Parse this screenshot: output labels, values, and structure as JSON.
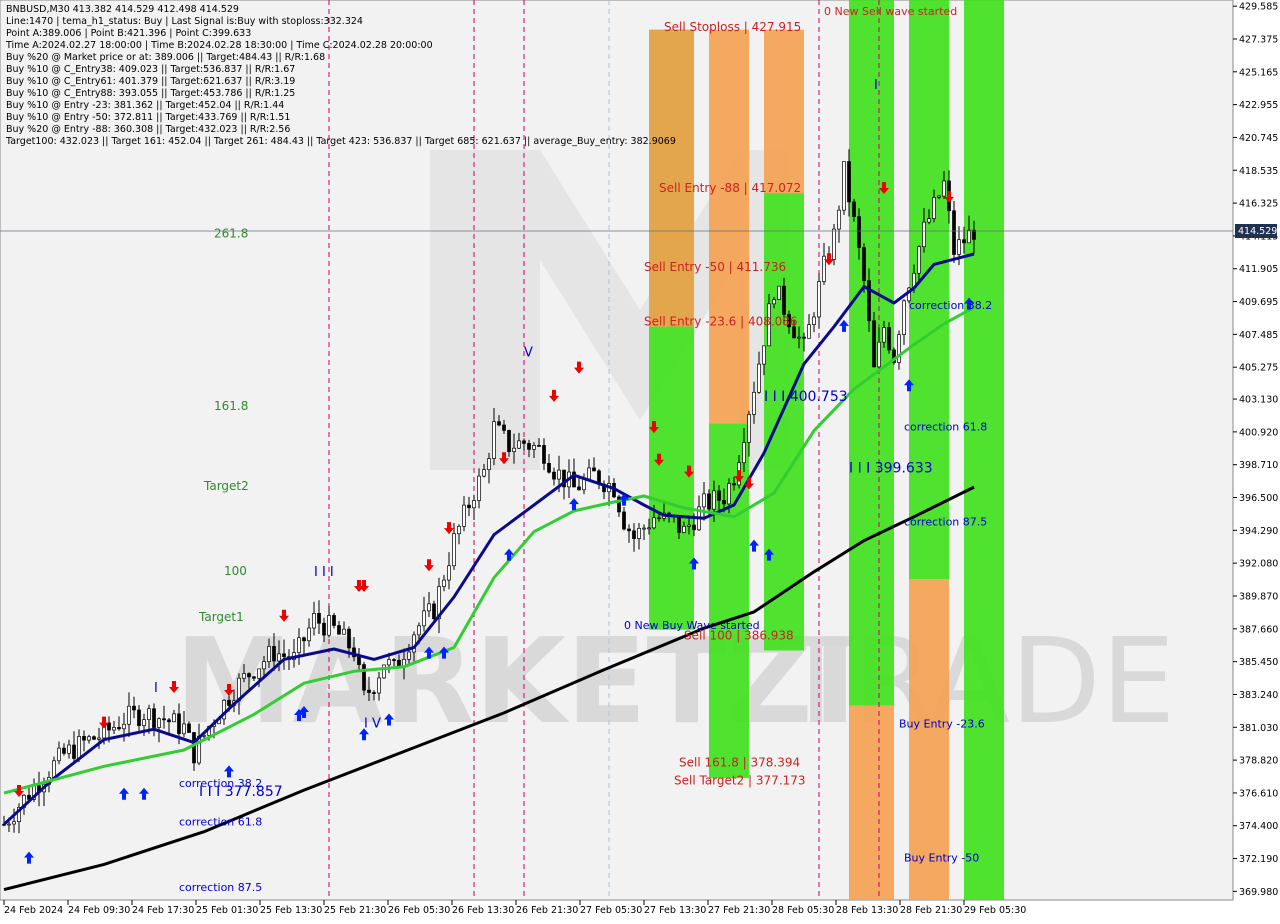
{
  "colors": {
    "background": "#ffffff",
    "plot_bg": "#f2f2f2",
    "watermark": "#d2d2d2",
    "candle": "#000000",
    "blue_line": "#0a0a8c",
    "green_line": "#33cc33",
    "black_line": "#000000",
    "green_zone": "#3de01a",
    "orange_zone": "#f4a050",
    "sell_text": "#cc2222",
    "buy_text": "#0000cc",
    "fib_text": "#2e8b2e",
    "vline_red": "#cc0066",
    "vline_blue": "#9ec8e0",
    "arrow_red": "#ee0000",
    "arrow_blue": "#0022ff",
    "price_tag": "#203050"
  },
  "header": {
    "lines": [
      "BNBUSD,M30  413.382 414.529 412.498 414.529",
      "Line:1470  | tema_h1_status: Buy  | Last Signal is:Buy with stoploss:332.324",
      "Point A:389.006 | Point B:421.396 | Point C:399.633",
      "Time A:2024.02.27 18:00:00 | Time B:2024.02.28 18:30:00 | Time C:2024.02.28 20:00:00",
      "Buy %20 @ Market price or at: 389.006  ||  Target:484.43  ||  R/R:1.68",
      "Buy %10 @ C_Entry38: 409.023  ||  Target:536.837  ||  R/R:1.67",
      "Buy %10 @ C_Entry61: 401.379  ||  Target:621.637  ||  R/R:3.19",
      "Buy %10 @ C_Entry88: 393.055  ||  Target:453.786  ||  R/R:1.25",
      "Buy %10 @ Entry -23: 381.362  ||  Target:452.04  ||  R/R:1.44",
      "Buy %10 @ Entry -50: 372.811  ||  Target:433.769  ||  R/R:1.51",
      "Buy %20 @ Entry -88: 360.308  ||  Target:432.023  ||  R/R:2.56",
      "Target100: 432.023  ||  Target 161: 452.04  ||  Target 261: 484.43  ||  Target 423: 536.837  ||  Target 685: 621.637  ||  average_Buy_entry: 382.9069"
    ]
  },
  "watermark": {
    "text_left": "MARKETZI",
    "text_right": "TRADE"
  },
  "current_price": "414.529",
  "chart_data": {
    "type": "candlestick",
    "symbol": "BNBUSD",
    "timeframe": "M30",
    "ylim": [
      369.4,
      430.0
    ],
    "y_ticks": [
      "429.585",
      "427.375",
      "425.165",
      "422.955",
      "420.745",
      "418.535",
      "416.325",
      "414.115",
      "411.905",
      "409.695",
      "407.485",
      "405.275",
      "403.130",
      "400.920",
      "398.710",
      "396.500",
      "394.290",
      "392.080",
      "389.870",
      "387.660",
      "385.450",
      "383.240",
      "381.030",
      "378.820",
      "376.610",
      "374.400",
      "372.190",
      "369.980"
    ],
    "x_ticks": [
      "24 Feb 2024",
      "24 Feb 09:30",
      "24 Feb 17:30",
      "25 Feb 01:30",
      "25 Feb 13:30",
      "25 Feb 21:30",
      "26 Feb 05:30",
      "26 Feb 13:30",
      "26 Feb 21:30",
      "27 Feb 05:30",
      "27 Feb 13:30",
      "27 Feb 21:30",
      "28 Feb 05:30",
      "28 Feb 13:30",
      "28 Feb 21:30",
      "29 Feb 05:30"
    ],
    "close_path": [
      [
        0,
        374.5
      ],
      [
        4,
        376.2
      ],
      [
        8,
        377.8
      ],
      [
        12,
        379.2
      ],
      [
        16,
        380.0
      ],
      [
        20,
        380.6
      ],
      [
        24,
        381.6
      ],
      [
        28,
        382.0
      ],
      [
        32,
        381.6
      ],
      [
        36,
        381.0
      ],
      [
        38,
        379.3
      ],
      [
        42,
        381.7
      ],
      [
        46,
        383.6
      ],
      [
        50,
        385.0
      ],
      [
        54,
        386.1
      ],
      [
        58,
        385.6
      ],
      [
        62,
        388.3
      ],
      [
        66,
        387.6
      ],
      [
        70,
        386.2
      ],
      [
        72,
        383.0
      ],
      [
        74,
        384.0
      ],
      [
        76,
        385.5
      ],
      [
        78,
        384.9
      ],
      [
        82,
        387.5
      ],
      [
        86,
        389.0
      ],
      [
        90,
        393.6
      ],
      [
        94,
        396.9
      ],
      [
        96,
        398.2
      ],
      [
        98,
        401.2
      ],
      [
        101,
        400.0
      ],
      [
        104,
        400.2
      ],
      [
        108,
        399.6
      ],
      [
        110,
        398.4
      ],
      [
        114,
        397.1
      ],
      [
        118,
        398.0
      ],
      [
        122,
        397.2
      ],
      [
        124,
        395.0
      ],
      [
        126,
        393.8
      ],
      [
        128,
        394.5
      ],
      [
        130,
        395.2
      ],
      [
        134,
        394.8
      ],
      [
        136,
        394.2
      ],
      [
        140,
        396.0
      ],
      [
        144,
        396.6
      ],
      [
        146,
        398.0
      ],
      [
        150,
        404.0
      ],
      [
        154,
        410.6
      ],
      [
        157,
        408.6
      ],
      [
        160,
        406.5
      ],
      [
        164,
        412.0
      ],
      [
        166,
        414.1
      ],
      [
        168,
        418.4
      ],
      [
        170,
        415.0
      ],
      [
        172,
        411.0
      ],
      [
        174,
        405.0
      ],
      [
        176,
        408.0
      ],
      [
        178,
        406.0
      ],
      [
        180,
        410.0
      ],
      [
        184,
        414.5
      ],
      [
        188,
        417.6
      ],
      [
        190,
        413.1
      ],
      [
        194,
        414.529
      ]
    ],
    "n_bars": 194,
    "series": [
      {
        "name": "",
        "color": "blue_line",
        "points": [
          [
            0,
            374.5
          ],
          [
            10,
            377.6
          ],
          [
            20,
            380.2
          ],
          [
            30,
            380.9
          ],
          [
            38,
            380.0
          ],
          [
            46,
            382.6
          ],
          [
            56,
            385.6
          ],
          [
            66,
            386.3
          ],
          [
            74,
            385.6
          ],
          [
            82,
            386.4
          ],
          [
            90,
            389.8
          ],
          [
            98,
            394.0
          ],
          [
            106,
            396.0
          ],
          [
            114,
            398.0
          ],
          [
            122,
            397.1
          ],
          [
            128,
            396.0
          ],
          [
            132,
            395.3
          ],
          [
            140,
            395.1
          ],
          [
            146,
            396.0
          ],
          [
            152,
            399.5
          ],
          [
            160,
            405.5
          ],
          [
            166,
            408.0
          ],
          [
            172,
            410.7
          ],
          [
            178,
            409.6
          ],
          [
            182,
            410.6
          ],
          [
            186,
            412.2
          ],
          [
            194,
            412.9
          ]
        ]
      },
      {
        "name": "",
        "color": "green_line",
        "points": [
          [
            0,
            376.6
          ],
          [
            20,
            378.4
          ],
          [
            36,
            379.5
          ],
          [
            50,
            381.9
          ],
          [
            60,
            384.0
          ],
          [
            70,
            384.8
          ],
          [
            80,
            385.1
          ],
          [
            90,
            386.4
          ],
          [
            98,
            391.1
          ],
          [
            106,
            394.2
          ],
          [
            114,
            395.6
          ],
          [
            122,
            396.2
          ],
          [
            128,
            396.6
          ],
          [
            136,
            395.8
          ],
          [
            146,
            395.2
          ],
          [
            154,
            396.8
          ],
          [
            162,
            401.0
          ],
          [
            170,
            403.8
          ],
          [
            176,
            405.3
          ],
          [
            182,
            406.8
          ],
          [
            188,
            408.2
          ],
          [
            194,
            409.3
          ]
        ]
      },
      {
        "name": "",
        "color": "black_line",
        "points": [
          [
            0,
            370.1
          ],
          [
            20,
            371.8
          ],
          [
            40,
            374.0
          ],
          [
            60,
            376.8
          ],
          [
            80,
            379.4
          ],
          [
            100,
            382.0
          ],
          [
            120,
            384.9
          ],
          [
            140,
            387.7
          ],
          [
            150,
            388.8
          ],
          [
            162,
            391.5
          ],
          [
            172,
            393.6
          ],
          [
            182,
            395.2
          ],
          [
            194,
            397.2
          ]
        ]
      }
    ],
    "vertical_lines": [
      {
        "time_bar": 65,
        "style": "red"
      },
      {
        "time_bar": 94,
        "style": "red"
      },
      {
        "time_bar": 104,
        "style": "red"
      },
      {
        "time_bar": 121,
        "style": "blue"
      },
      {
        "time_bar": 163,
        "style": "red"
      },
      {
        "time_bar": 175,
        "style": "red"
      }
    ],
    "zones": [
      {
        "color": "green_zone",
        "x_from": 129,
        "x_to": 138,
        "y_from": 387.6,
        "y_to": 428.0
      },
      {
        "color": "orange_zone",
        "x_from": 129,
        "x_to": 138,
        "y_from": 408.0,
        "y_to": 428.0
      },
      {
        "color": "green_zone",
        "x_from": 141,
        "x_to": 149,
        "y_from": 377.6,
        "y_to": 401.5
      },
      {
        "color": "orange_zone",
        "x_from": 141,
        "x_to": 149,
        "y_from": 401.5,
        "y_to": 428.0
      },
      {
        "color": "green_zone",
        "x_from": 152,
        "x_to": 160,
        "y_from": 386.2,
        "y_to": 417.0
      },
      {
        "color": "orange_zone",
        "x_from": 152,
        "x_to": 160,
        "y_from": 417.0,
        "y_to": 428.0
      },
      {
        "color": "green_zone",
        "x_from": 169,
        "x_to": 178,
        "y_from": 382.5,
        "y_to": 430.0
      },
      {
        "color": "orange_zone",
        "x_from": 169,
        "x_to": 178,
        "y_from": 369.4,
        "y_to": 382.5
      },
      {
        "color": "green_zone",
        "x_from": 181,
        "x_to": 189,
        "y_from": 391.0,
        "y_to": 430.0
      },
      {
        "color": "orange_zone",
        "x_from": 181,
        "x_to": 189,
        "y_from": 369.4,
        "y_to": 391.0
      },
      {
        "color": "green_zone",
        "x_from": 192,
        "x_to": 200,
        "y_from": 369.4,
        "y_to": 430.0
      }
    ],
    "up_arrows": [
      [
        5,
        373.2
      ],
      [
        24,
        377.5
      ],
      [
        28,
        377.5
      ],
      [
        45,
        379.0
      ],
      [
        59,
        382.8
      ],
      [
        60,
        383.0
      ],
      [
        72,
        381.5
      ],
      [
        77,
        382.5
      ],
      [
        85,
        387.0
      ],
      [
        88,
        387.0
      ],
      [
        101,
        393.6
      ],
      [
        114,
        397.0
      ],
      [
        124,
        397.3
      ],
      [
        138,
        393.0
      ],
      [
        150,
        394.2
      ],
      [
        153,
        393.6
      ],
      [
        168,
        409.0
      ],
      [
        181,
        405.0
      ],
      [
        193,
        410.5
      ]
    ],
    "down_arrows": [
      [
        3,
        375.8
      ],
      [
        20,
        380.4
      ],
      [
        34,
        382.8
      ],
      [
        45,
        382.6
      ],
      [
        56,
        387.6
      ],
      [
        71,
        389.6
      ],
      [
        72,
        389.6
      ],
      [
        85,
        391.0
      ],
      [
        89,
        393.5
      ],
      [
        100,
        398.2
      ],
      [
        110,
        402.4
      ],
      [
        115,
        404.3
      ],
      [
        130,
        400.3
      ],
      [
        131,
        398.1
      ],
      [
        137,
        397.3
      ],
      [
        147,
        397.0
      ],
      [
        149,
        396.5
      ],
      [
        165,
        411.6
      ],
      [
        176,
        416.4
      ],
      [
        189,
        415.8
      ]
    ],
    "price_labels": [
      {
        "text": "Sell Stoploss | 427.915",
        "color": "sell_text",
        "time_bar": 132,
        "price": 427.915,
        "size": 12
      },
      {
        "text": "Sell Entry -88 | 417.072",
        "color": "sell_text",
        "time_bar": 131,
        "price": 417.072,
        "size": 12
      },
      {
        "text": "Sell Entry -50 | 411.736",
        "color": "sell_text",
        "time_bar": 128,
        "price": 411.736,
        "size": 12
      },
      {
        "text": "Sell Entry -23.6 | 408.086",
        "color": "sell_text",
        "time_bar": 128,
        "price": 408.086,
        "size": 12
      },
      {
        "text": "I I I  400.753",
        "color": "buy_text",
        "time_bar": 152,
        "price": 403.0,
        "size": 14
      },
      {
        "text": "I I I  399.633",
        "color": "buy_text",
        "time_bar": 169,
        "price": 398.2,
        "size": 14
      },
      {
        "text": "Sell 100 | 386.938",
        "color": "sell_text",
        "time_bar": 136,
        "price": 386.938,
        "size": 12
      },
      {
        "text": "Sell 161.8 | 378.394",
        "color": "sell_text",
        "time_bar": 135,
        "price": 378.394,
        "size": 12
      },
      {
        "text": "Sell Target2 | 377.173",
        "color": "sell_text",
        "time_bar": 134,
        "price": 377.173,
        "size": 12
      },
      {
        "text": "0 New Sell wave started",
        "color": "sell_text",
        "time_bar": 164,
        "price": 429.0,
        "size": 11
      },
      {
        "text": "0 New Buy Wave started",
        "color": "buy_text",
        "time_bar": 124,
        "price": 387.66,
        "size": 11
      },
      {
        "text": "correction 38.2",
        "color": "buy_text",
        "time_bar": 181,
        "price": 409.2,
        "size": 11
      },
      {
        "text": "correction 61.8",
        "color": "buy_text",
        "time_bar": 180,
        "price": 401.0,
        "size": 11
      },
      {
        "text": "correction 87.5",
        "color": "buy_text",
        "time_bar": 180,
        "price": 394.6,
        "size": 11
      },
      {
        "text": "Buy Entry -23.6",
        "color": "buy_text",
        "time_bar": 179,
        "price": 381.0,
        "size": 11
      },
      {
        "text": "Buy Entry -50",
        "color": "buy_text",
        "time_bar": 180,
        "price": 372.0,
        "size": 11
      },
      {
        "text": "I I I  377.857",
        "color": "buy_text",
        "time_bar": 39,
        "price": 376.4,
        "size": 14
      },
      {
        "text": "correction 38.2",
        "color": "buy_text",
        "time_bar": 35,
        "price": 377.0,
        "size": 11
      },
      {
        "text": "correction 61.8",
        "color": "buy_text",
        "time_bar": 35,
        "price": 374.4,
        "size": 11
      },
      {
        "text": "correction 87.5",
        "color": "buy_text",
        "time_bar": 35,
        "price": 370.0,
        "size": 11
      },
      {
        "text": "I V",
        "color": "buy_text",
        "time_bar": 72,
        "price": 381.0,
        "size": 13
      },
      {
        "text": "I I I",
        "color": "buy_text",
        "time_bar": 62,
        "price": 391.2,
        "size": 13
      },
      {
        "text": "I",
        "color": "buy_text",
        "time_bar": 30,
        "price": 383.4,
        "size": 13
      },
      {
        "text": "V",
        "color": "buy_text",
        "time_bar": 104,
        "price": 406.0,
        "size": 13
      },
      {
        "text": "I",
        "color": "buy_text",
        "time_bar": 174,
        "price": 424.0,
        "size": 13
      },
      {
        "text": "261.8",
        "color": "fib_text",
        "time_bar": 42,
        "price": 414.0,
        "size": 12
      },
      {
        "text": "161.8",
        "color": "fib_text",
        "time_bar": 42,
        "price": 402.4,
        "size": 12
      },
      {
        "text": "Target2",
        "color": "fib_text",
        "time_bar": 40,
        "price": 397.0,
        "size": 12
      },
      {
        "text": "100",
        "color": "fib_text",
        "time_bar": 44,
        "price": 391.3,
        "size": 12
      },
      {
        "text": "Target1",
        "color": "fib_text",
        "time_bar": 39,
        "price": 388.2,
        "size": 12
      }
    ]
  }
}
